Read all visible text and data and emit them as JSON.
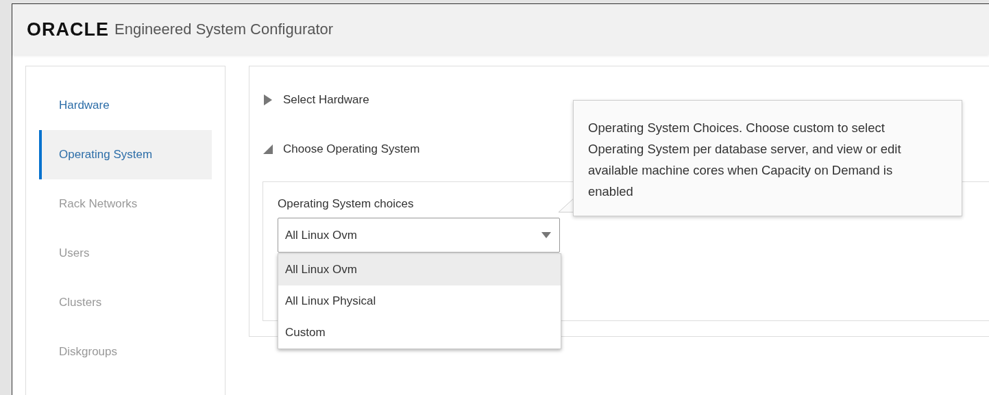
{
  "header": {
    "logo": "ORACLE",
    "title": "Engineered System Configurator"
  },
  "sidebar": {
    "items": [
      {
        "label": "Hardware",
        "selected": false,
        "disabled": false
      },
      {
        "label": "Operating System",
        "selected": true,
        "disabled": false
      },
      {
        "label": "Rack Networks",
        "selected": false,
        "disabled": true
      },
      {
        "label": "Users",
        "selected": false,
        "disabled": true
      },
      {
        "label": "Clusters",
        "selected": false,
        "disabled": true
      },
      {
        "label": "Diskgroups",
        "selected": false,
        "disabled": true
      }
    ]
  },
  "sections": [
    {
      "title": "Select Hardware",
      "expanded": false
    },
    {
      "title": "Choose Operating System",
      "expanded": true
    }
  ],
  "os_field": {
    "label": "Operating System choices",
    "value": "All Linux Ovm",
    "open": true,
    "options": [
      {
        "label": "All Linux Ovm",
        "selected": true
      },
      {
        "label": "All Linux Physical",
        "selected": false
      },
      {
        "label": "Custom",
        "selected": false
      }
    ]
  },
  "tooltip": {
    "text": "Operating System Choices. Choose custom to select Operating System per database server, and view or edit available machine cores when Capacity on Demand is enabled"
  }
}
